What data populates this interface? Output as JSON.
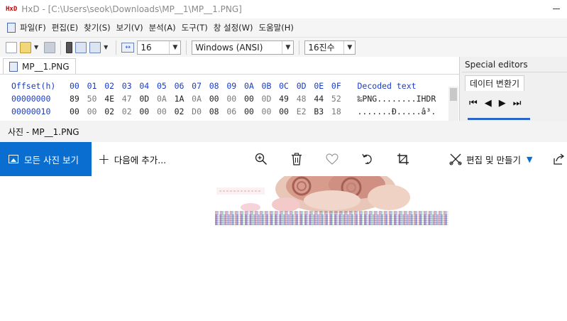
{
  "hxd": {
    "title": "HxD - [C:\\Users\\seok\\Downloads\\MP__1\\MP__1.PNG]",
    "menu": [
      "파일(F)",
      "편집(E)",
      "찾기(S)",
      "보기(V)",
      "분석(A)",
      "도구(T)",
      "창 설정(W)",
      "도움말(H)"
    ],
    "toolbar": {
      "bytes_per_row": "16",
      "charset": "Windows (ANSI)",
      "offset_base": "16진수"
    },
    "file_tab": "MP__1.PNG",
    "hex": {
      "offset_header": "Offset(h)",
      "column_headers": [
        "00",
        "01",
        "02",
        "03",
        "04",
        "05",
        "06",
        "07",
        "08",
        "09",
        "0A",
        "0B",
        "0C",
        "0D",
        "0E",
        "0F"
      ],
      "decoded_header": "Decoded text",
      "rows": [
        {
          "offset": "00000000",
          "bytes": [
            "89",
            "50",
            "4E",
            "47",
            "0D",
            "0A",
            "1A",
            "0A",
            "00",
            "00",
            "00",
            "0D",
            "49",
            "48",
            "44",
            "52"
          ],
          "decoded": "‰PNG........IHDR"
        },
        {
          "offset": "00000010",
          "bytes": [
            "00",
            "00",
            "02",
            "02",
            "00",
            "00",
            "02",
            "D0",
            "08",
            "06",
            "00",
            "00",
            "00",
            "E2",
            "B3",
            "18"
          ],
          "decoded": ".......Ð.....â³."
        }
      ]
    },
    "special_editors": {
      "title": "Special editors",
      "tab": "데이터 변환기"
    }
  },
  "photos": {
    "title": "사진 - MP__1.PNG",
    "all_photos_label": "모든 사진 보기",
    "add_to_label": "다음에 추가...",
    "edit_create_label": "편집 및 만들기",
    "accent_color": "#0a6dd0"
  }
}
